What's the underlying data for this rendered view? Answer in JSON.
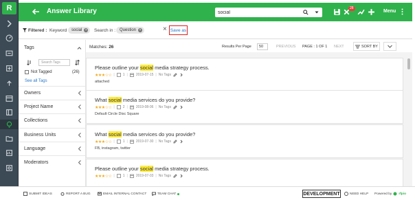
{
  "app": {
    "logo": "R",
    "title": "Answer Library",
    "notification_count": "28",
    "menu_label": "Menu"
  },
  "search": {
    "value": "social",
    "placeholder": ""
  },
  "filters": {
    "filtered_label": "Filtered :",
    "keyword_label": "Keyword",
    "keyword_value": "social",
    "search_in_label": "Search in :",
    "search_in_value": "Question",
    "save_as_label": "Save as"
  },
  "left_panel": {
    "tags_title": "Tags",
    "tag_search_placeholder": "Search Tags",
    "not_tagged_label": "Not Tagged",
    "not_tagged_count": "(26)",
    "see_all_label": "See all Tags",
    "sections": [
      "Owners",
      "Project Name",
      "Collections",
      "Business Units",
      "Language",
      "Moderators"
    ]
  },
  "results_header": {
    "matches_label": "Matches:",
    "matches_count": "26",
    "results_per_page_label": "Results Per Page",
    "results_per_page_value": "50",
    "previous_label": "PREVIOUS",
    "page_label": "PAGE : 1 OF 1",
    "next_label": "NEXT",
    "sort_label": "SORT BY"
  },
  "results": [
    {
      "pre": "Please outline your ",
      "hl": "social",
      "post": " media strategy process.",
      "stars": "★★★☆☆",
      "count": "1",
      "date": "2019-07-15",
      "tag_status": "No Tags",
      "tags": "attached"
    },
    {
      "pre": "What ",
      "hl": "social",
      "post": " media services do you provide?",
      "stars": "★★★☆☆",
      "count": "2",
      "date": "2019-08-06",
      "tag_status": "No Tags",
      "tags": "Default Circle Disc Square"
    },
    {
      "pre": "What ",
      "hl": "social",
      "post": " media services do you provide?",
      "stars": "★★★☆☆",
      "count": "1",
      "date": "2019-07-30",
      "tag_status": "No Tags",
      "tags": "FB, instagram, twitter"
    },
    {
      "pre": "Please outline your ",
      "hl": "social",
      "post": " media strategy process.",
      "stars": "★★★☆☆",
      "count": "1",
      "date": "2019-07-03",
      "tag_status": "No Tags",
      "tags": ""
    }
  ],
  "footer": {
    "avatar_initials": "SG",
    "submit_ideas": "SUBMIT IDEAS",
    "report_bug": "REPORT A BUG",
    "email_contact": "EMAIL INTERNAL CONTACT",
    "team_chat": "TEAM CHAT",
    "environment": "DEVELOPMENT",
    "need_help": "NEED HELP",
    "powered_by": "Powered by",
    "brand": "rfpio"
  },
  "colors": {
    "brand_green": "#2fb24c",
    "rail": "#3c4a55",
    "highlight": "#ffeb3b",
    "link": "#2a77c9",
    "save_border": "#e02020"
  }
}
